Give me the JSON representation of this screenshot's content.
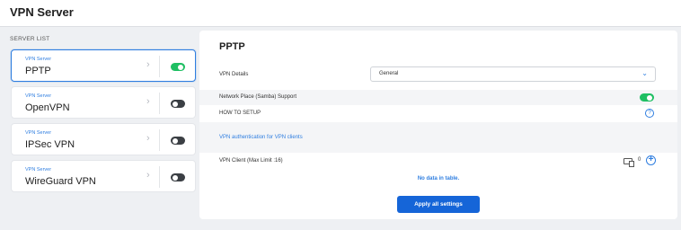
{
  "header": {
    "title": "VPN Server"
  },
  "server_list": {
    "label": "SERVER LIST",
    "items": [
      {
        "sub": "VPN Server",
        "name": "PPTP",
        "enabled": true,
        "active": true
      },
      {
        "sub": "VPN Server",
        "name": "OpenVPN",
        "enabled": false,
        "active": false
      },
      {
        "sub": "VPN Server",
        "name": "IPSec VPN",
        "enabled": false,
        "active": false
      },
      {
        "sub": "VPN Server",
        "name": "WireGuard VPN",
        "enabled": false,
        "active": false
      }
    ]
  },
  "panel": {
    "title": "PPTP",
    "vpn_details_label": "VPN Details",
    "vpn_details_value": "General",
    "samba_label": "Network Place (Samba) Support",
    "samba_enabled": true,
    "how_to_setup_label": "HOW TO SETUP",
    "auth_link": "VPN authentication for VPN clients",
    "client_label": "VPN Client (Max Limit :16)",
    "client_count": "0",
    "no_data": "No data in table.",
    "apply_label": "Apply all settings"
  },
  "icons": {
    "chevron": "chevron-right-icon",
    "help": "question-circle-icon",
    "add": "plus-circle-icon",
    "devices": "devices-icon"
  },
  "colors": {
    "accent": "#2f7ee0",
    "toggle_on": "#1fbf63",
    "toggle_off": "#3b3f44",
    "button": "#1565d8"
  }
}
